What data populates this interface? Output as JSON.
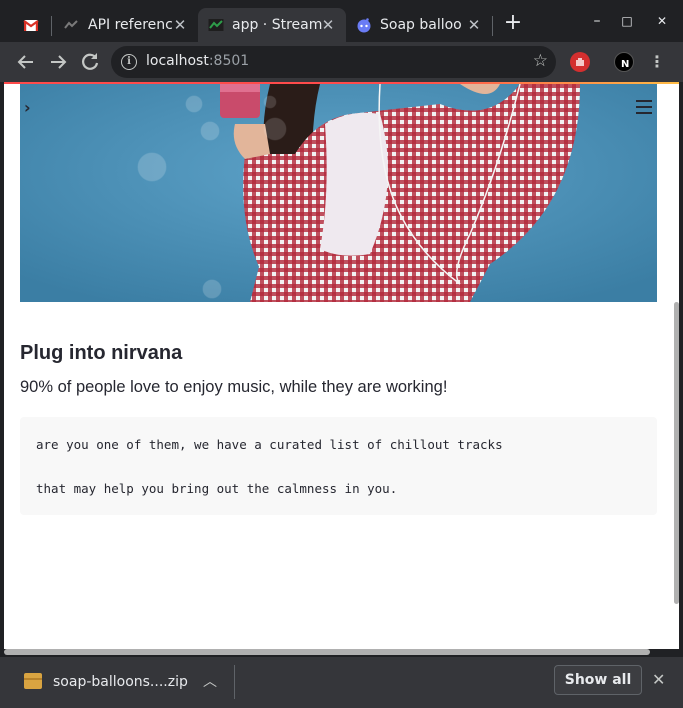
{
  "tabs": [
    {
      "title": "",
      "favicon": "gmail-icon"
    },
    {
      "title": "API referenc",
      "favicon": "streamlit-icon"
    },
    {
      "title": "app · Stream",
      "favicon": "streamlit-icon",
      "active": true
    },
    {
      "title": "Soap balloo",
      "favicon": "reddit-icon"
    }
  ],
  "window_controls": {
    "minimize": "–",
    "maximize": "□",
    "close": "✕"
  },
  "address_bar": {
    "host": "localhost",
    "port": ":8501"
  },
  "page": {
    "heading": "Plug into nirvana",
    "lead": "90% of people love to enjoy music, while they are working!",
    "code_lines": [
      "are you one of them, we have a curated list of chillout tracks",
      "that may help you bring out the calmness in you."
    ]
  },
  "download": {
    "filename": "soap-balloons....zip",
    "show_all": "Show all"
  },
  "colors": {
    "accent": "#ff4b4b",
    "hero_bg": "#4a90b8",
    "chrome_dark": "#202124",
    "chrome_toolbar": "#35363a"
  }
}
